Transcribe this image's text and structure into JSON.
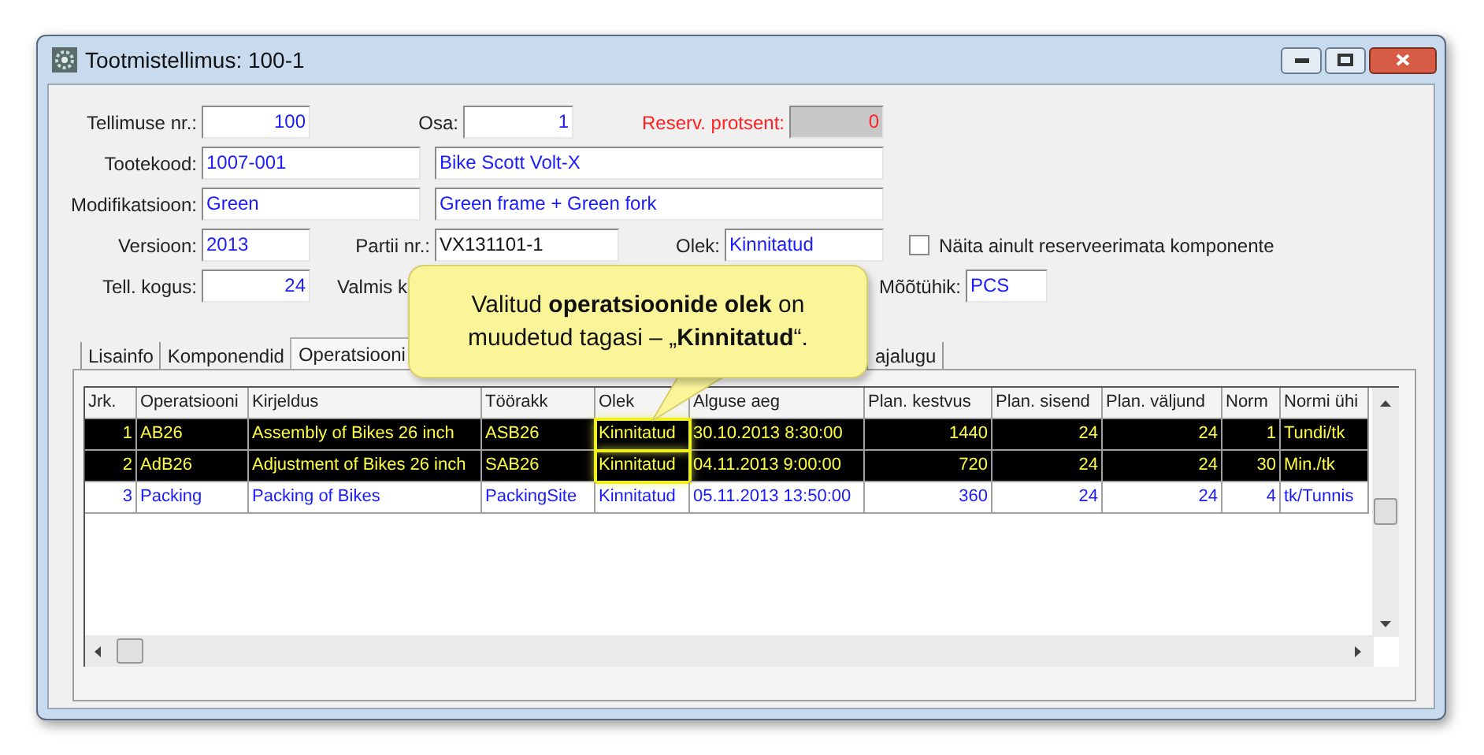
{
  "window": {
    "title": "Tootmistellimus: 100-1"
  },
  "form": {
    "order_no": {
      "label": "Tellimuse nr.:",
      "value": "100"
    },
    "part": {
      "label": "Osa:",
      "value": "1"
    },
    "reserve_percent": {
      "label": "Reserv. protsent:",
      "value": "0",
      "disabled": true
    },
    "product_code": {
      "label": "Tootekood:",
      "value": "1007-001",
      "description": "Bike Scott Volt-X"
    },
    "modification": {
      "label": "Modifikatsioon:",
      "value": "Green",
      "description": "Green frame + Green fork"
    },
    "version": {
      "label": "Versioon:",
      "value": "2013"
    },
    "batch_no": {
      "label": "Partii nr.:",
      "value": "VX131101-1"
    },
    "status": {
      "label": "Olek:",
      "value": "Kinnitatud"
    },
    "unreserved_only": {
      "label": "Näita ainult reserveerimata komponente",
      "checked": false
    },
    "order_qty": {
      "label": "Tell. kogus:",
      "value": "24"
    },
    "finished_qty": {
      "label": "Valmis k"
    },
    "unit": {
      "label": "Mõõtühik:",
      "value": "PCS"
    }
  },
  "tabs": [
    {
      "label": "Lisainfo",
      "selected": false
    },
    {
      "label": "Komponendid",
      "selected": false
    },
    {
      "label": "Operatsiooni",
      "selected": true
    },
    {
      "label": "ajalugu",
      "selected": false
    }
  ],
  "table": {
    "columns": [
      "Jrk.",
      "Operatsiooni",
      "Kirjeldus",
      "Töörakk",
      "Olek",
      "Alguse aeg",
      "Plan. kestvus",
      "Plan. sisend",
      "Plan. väljund",
      "Norm",
      "Normi ühi"
    ],
    "rows": [
      {
        "selected": true,
        "highlighted": true,
        "cells": [
          "1",
          "AB26",
          "Assembly of Bikes 26 inch",
          "ASB26",
          "Kinnitatud",
          "30.10.2013 8:30:00",
          "1440",
          "24",
          "24",
          "1",
          "Tundi/tk"
        ]
      },
      {
        "selected": true,
        "highlighted": true,
        "cells": [
          "2",
          "AdB26",
          "Adjustment of Bikes 26 inch",
          "SAB26",
          "Kinnitatud",
          "04.11.2013 9:00:00",
          "720",
          "24",
          "24",
          "30",
          "Min./tk"
        ]
      },
      {
        "selected": false,
        "highlighted": false,
        "cells": [
          "3",
          "Packing",
          "Packing of Bikes",
          "PackingSite",
          "Kinnitatud",
          "05.11.2013 13:50:00",
          "360",
          "24",
          "24",
          "4",
          "tk/Tunnis"
        ]
      }
    ]
  },
  "callout": {
    "text": "Valitud **operatsioonide olek** on muudetud tagasi – „**Kinnitatud**“."
  }
}
